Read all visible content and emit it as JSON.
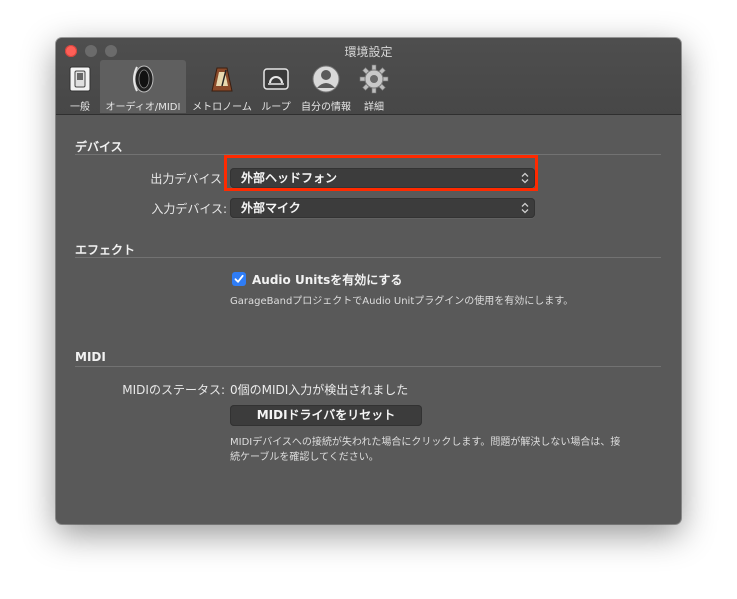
{
  "window": {
    "title": "環境設定"
  },
  "toolbar": {
    "tabs": [
      {
        "label": "一般",
        "icon": "switch-icon"
      },
      {
        "label": "オーディオ/MIDI",
        "icon": "speaker-icon",
        "selected": true
      },
      {
        "label": "メトロノーム",
        "icon": "metronome-icon"
      },
      {
        "label": "ループ",
        "icon": "loop-icon"
      },
      {
        "label": "自分の情報",
        "icon": "user-icon"
      },
      {
        "label": "詳細",
        "icon": "gear-icon"
      }
    ]
  },
  "devices": {
    "section_title": "デバイス",
    "output_label": "出力デバイス",
    "output_value": "外部ヘッドフォン",
    "input_label": "入力デバイス:",
    "input_value": "外部マイク"
  },
  "effects": {
    "section_title": "エフェクト",
    "checkbox_label": "Audio Unitsを有効にする",
    "checkbox_checked": true,
    "description": "GarageBandプロジェクトでAudio Unitプラグインの使用を有効にします。"
  },
  "midi": {
    "section_title": "MIDI",
    "status_label": "MIDIのステータス:",
    "status_value": "0個のMIDI入力が検出されました",
    "reset_button": "MIDIドライバをリセット",
    "description_line1": "MIDIデバイスへの接続が失われた場合にクリックします。問題が解決しない場合は、接",
    "description_line2": "続ケーブルを確認してください。"
  },
  "colors": {
    "window_bg": "#595959",
    "titlebar_bg": "#4b4b4b",
    "close_light": "#fe5f57",
    "checkbox_accent": "#2f7df6",
    "highlight_border": "#ff2a00"
  }
}
